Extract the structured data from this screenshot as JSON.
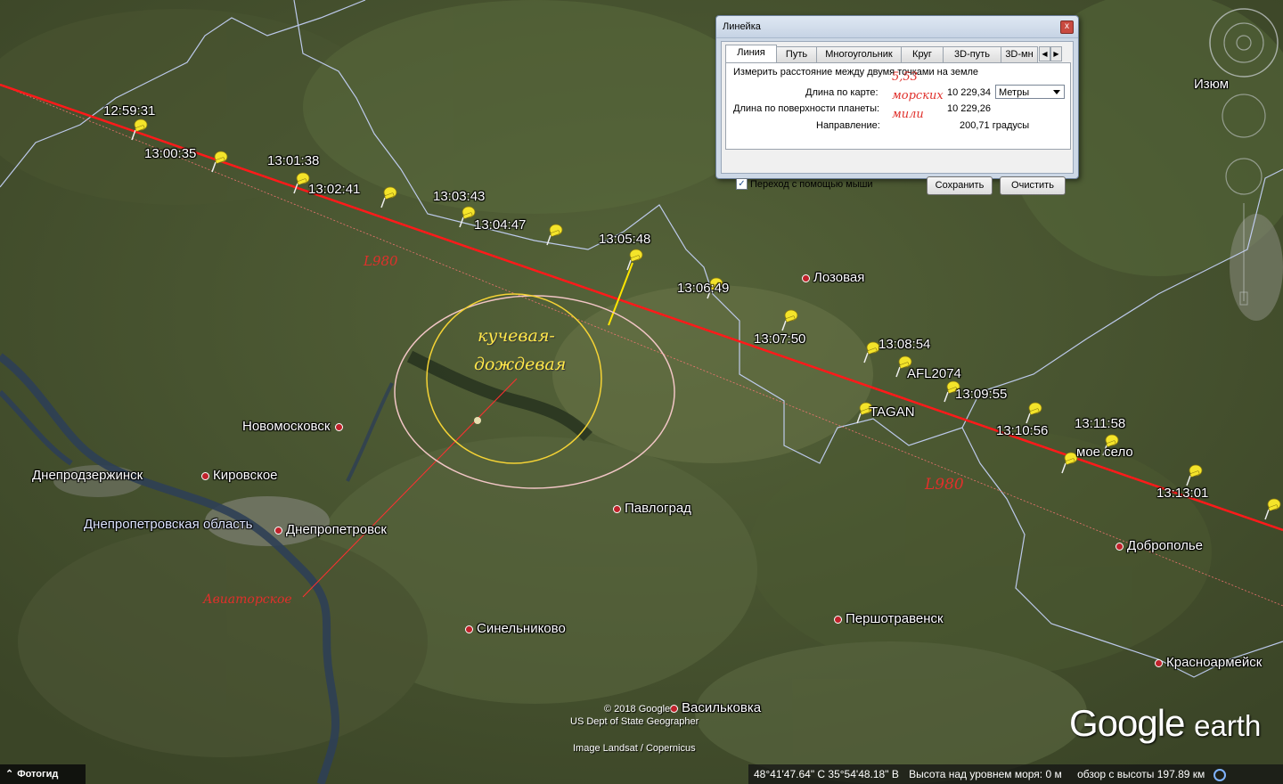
{
  "map": {
    "route": {
      "timestamps": [
        "12:59:31",
        "13:00:35",
        "13:01:38",
        "13:02:41",
        "13:03:43",
        "13:04:47",
        "13:05:48",
        "13:06:49",
        "13:07:50",
        "13:08:54",
        "13:09:55",
        "13:10:56",
        "13:11:58",
        "13:13:01"
      ]
    },
    "airway_label_1": "L980",
    "airway_label_2": "L980",
    "flight_label": "AFL2074",
    "tagan_label": "TAGAN",
    "cloud_note": [
      "кучевая-",
      "дождевая"
    ],
    "aviator_note": "Авиаторское",
    "ruler_note": [
      "5,53",
      "морских",
      "мили"
    ],
    "cities": {
      "izyum": "Изюм",
      "lozovaya": "Лозовая",
      "novomoskovsk": "Новомосковск",
      "dneprodzerzhinsk": "Днепродзержинск",
      "kirovskoe": "Кировское",
      "dnepr_oblast": "Днепропетровская область",
      "dnepropetrovsk": "Днепропетровск",
      "pavlograd": "Павлоград",
      "sinelnikovo": "Синельниково",
      "pershotravensk": "Першотравенск",
      "vasilkovka": "Васильковка",
      "dobropolie": "Доброполье",
      "krasnoarmeysk": "Красноармейск",
      "moe_selo": "мое село"
    }
  },
  "dialog": {
    "title": "Линейка",
    "close_glyph": "x",
    "tabs": [
      "Линия",
      "Путь",
      "Многоугольник",
      "Круг",
      "3D-путь",
      "3D-мн"
    ],
    "description": "Измерить расстояние между двумя точками на земле",
    "map_length_label": "Длина по карте:",
    "map_length_value": "10 229,34",
    "unit": "Метры",
    "surface_length_label": "Длина по поверхности планеты:",
    "surface_length_value": "10 229,26",
    "direction_label": "Направление:",
    "direction_value": "200,71 градусы",
    "mouse_nav_label": "Переход с помощью мыши",
    "mouse_nav_checked": "✓",
    "save_button": "Сохранить",
    "clear_button": "Очистить"
  },
  "footer": {
    "tour_guide": "Фотогид",
    "copyright": "© 2018 Google",
    "data_credit": "US Dept of State Geographer",
    "image_credit": "Image Landsat / Copernicus",
    "coords": "48°41'47.64\" С   35°54'48.18\" В",
    "elevation": "Высота над уровнем моря:     0 м",
    "eye_alt": "обзор с высоты 197.89 км",
    "logo_google": "Google",
    "logo_earth": "earth"
  },
  "colors": {
    "route": "#ff1a1a",
    "pin": "#f4e42a",
    "circle_outer": "#f2c6c6",
    "circle_inner": "#f5d335",
    "border": "#c9d6ff"
  }
}
